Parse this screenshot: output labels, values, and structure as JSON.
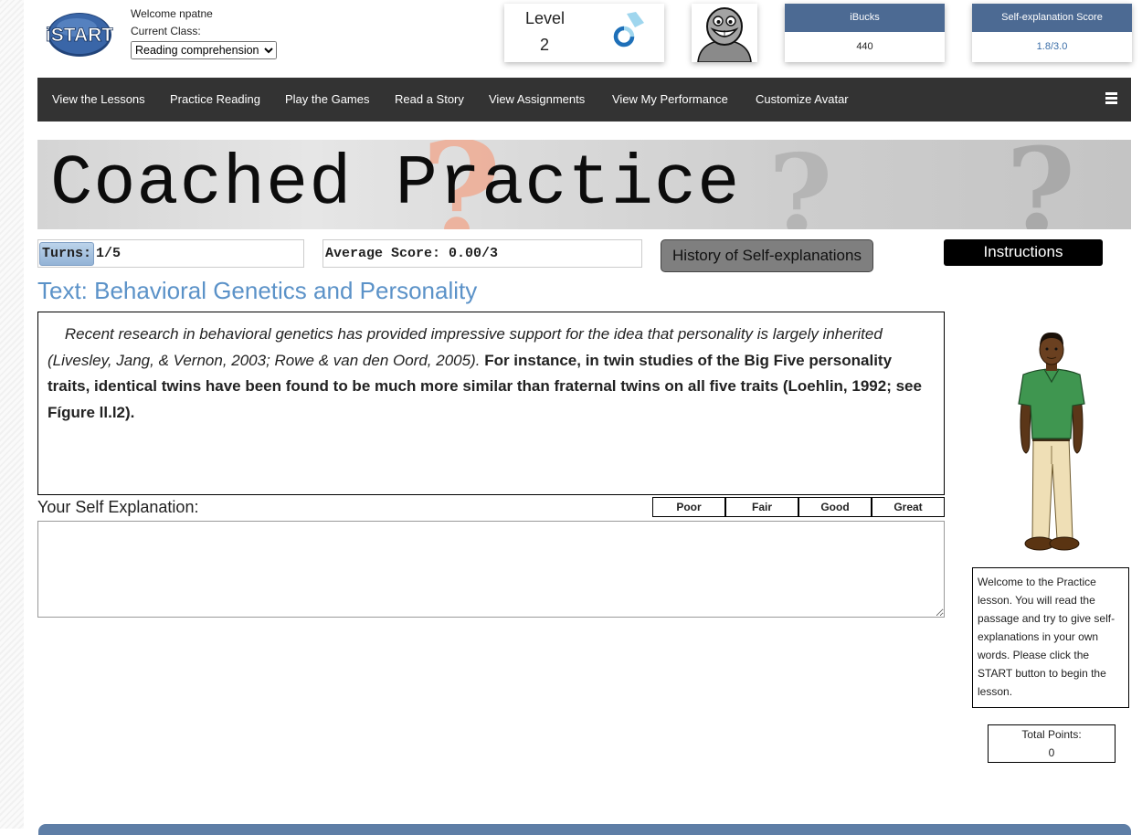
{
  "header": {
    "logo_text": "iSTART",
    "welcome": "Welcome npatne",
    "current_class_label": "Current Class:",
    "class_selected": "Reading comprehension",
    "level_label": "Level",
    "level_value": "2",
    "ibucks_label": "iBucks",
    "ibucks_value": "440",
    "se_score_label": "Self-explanation Score",
    "se_score_value": "1.8/3.0"
  },
  "nav": {
    "items": [
      {
        "label": "View the Lessons"
      },
      {
        "label": "Practice Reading"
      },
      {
        "label": "Play the Games"
      },
      {
        "label": "Read a Story"
      },
      {
        "label": "View Assignments"
      },
      {
        "label": "View My Performance"
      },
      {
        "label": "Customize Avatar"
      }
    ],
    "menu_icon": "hamburger-icon"
  },
  "banner": {
    "title": "Coached Practice"
  },
  "controls": {
    "turns_label": "Turns:",
    "turns_value": "1/5",
    "average_score": "Average Score: 0.00/3",
    "history_button": "History of Self-explanations",
    "instructions_button": "Instructions"
  },
  "text": {
    "title": "Text: Behavioral Genetics and Personality",
    "passage_italic": "Recent research in behavioral genetics has provided impressive support for the idea that personality is largely inherited (Livesley, Jang, & Vernon, 2003; Rowe & van den Oord, 2005).",
    "passage_bold": "For instance, in twin studies of the Big Five personality traits, identical twins have been found to be much more similar than fraternal twins on all five traits (Loehlin, 1992; see Fígure ll.l2)."
  },
  "self_explanation": {
    "label": "Your Self Explanation:",
    "value": "",
    "ratings": [
      {
        "label": "Poor"
      },
      {
        "label": "Fair"
      },
      {
        "label": "Good"
      },
      {
        "label": "Great"
      }
    ]
  },
  "sidebar": {
    "welcome_message": "Welcome to the Practice lesson. You will read the passage and try to give self-explanations in your own words. Please click the START button to begin the lesson.",
    "total_points_label": "Total Points:",
    "total_points_value": "0"
  },
  "colors": {
    "nav_bg": "#333333",
    "card_header": "#4c6a93",
    "title_blue": "#5b92c8",
    "score_blue": "#3b6ea8",
    "level_ring_dark": "#1e6fb8",
    "level_ring_light": "#9fd6ee"
  },
  "level_progress": 0.25
}
